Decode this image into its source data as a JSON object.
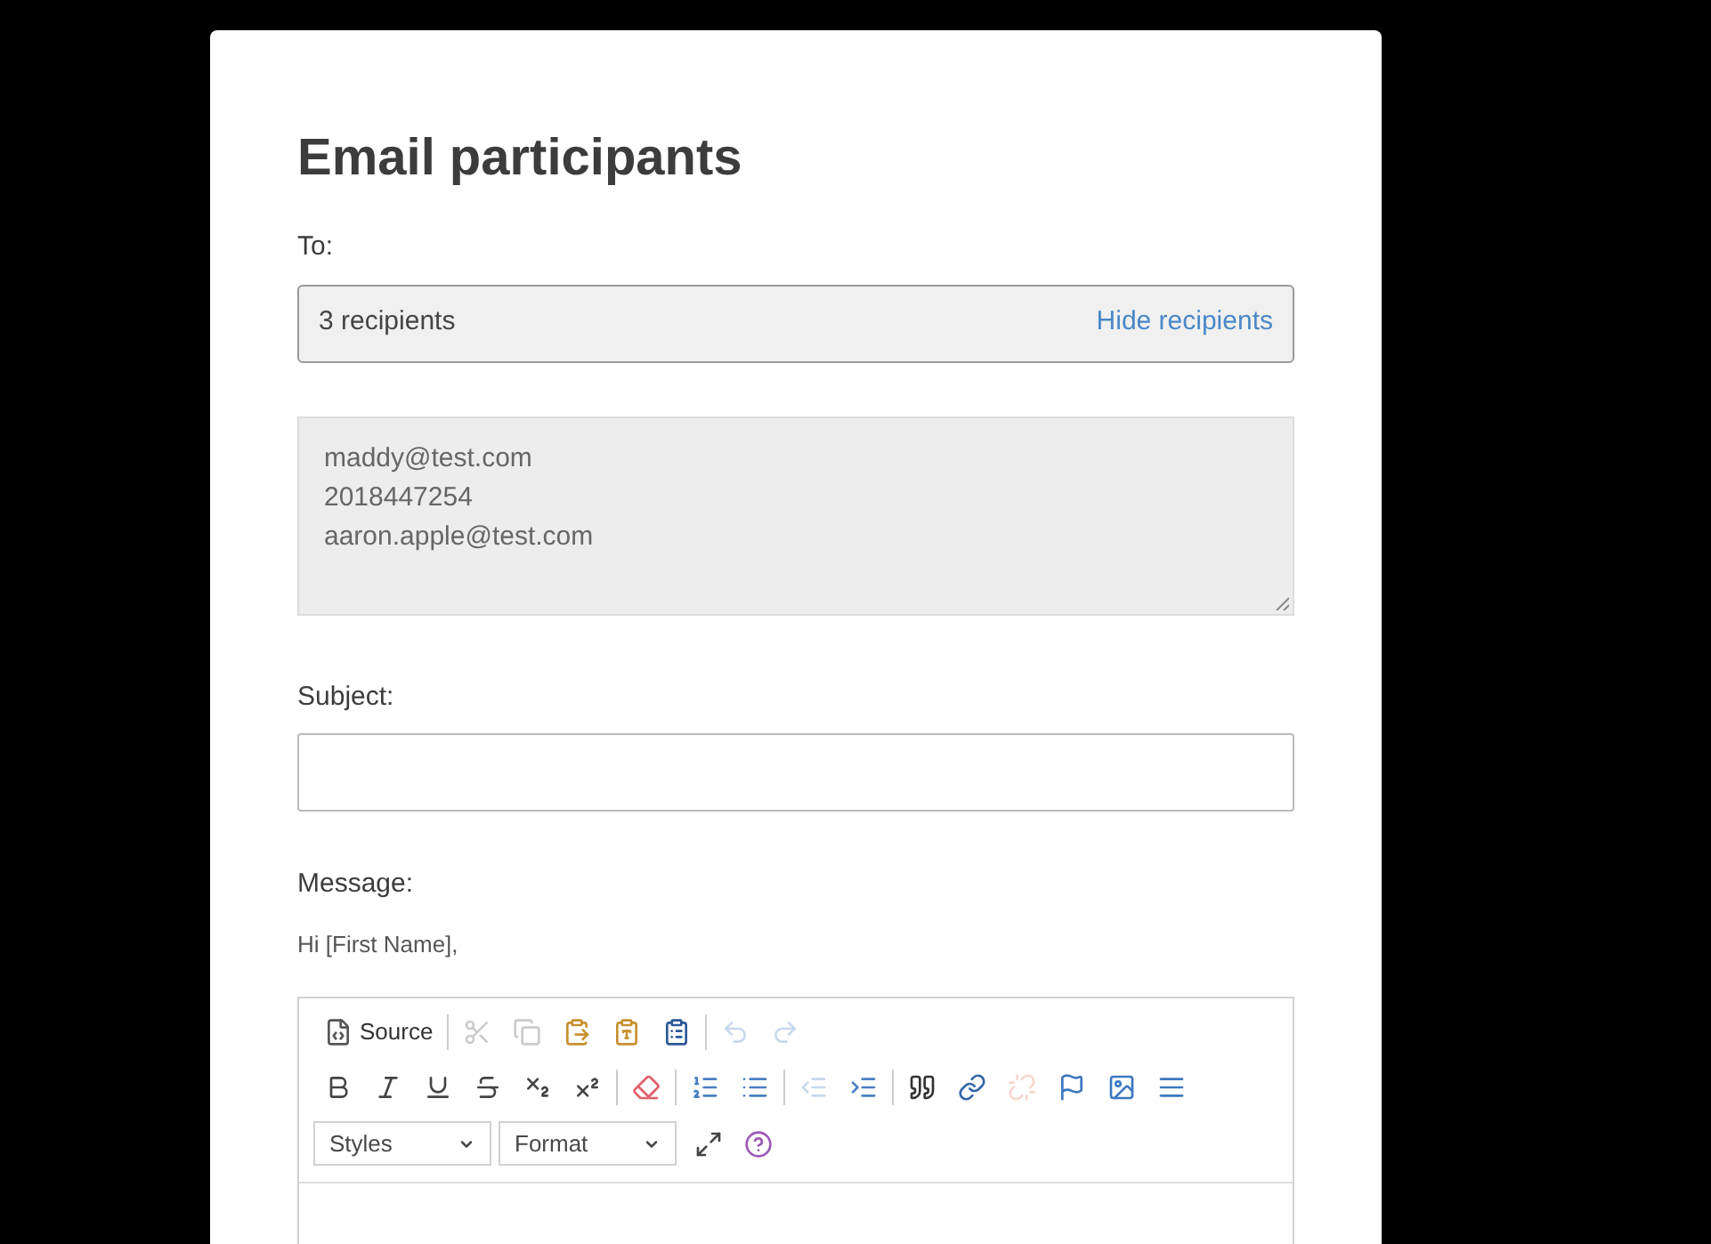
{
  "dialog": {
    "title": "Email participants"
  },
  "to": {
    "label": "To:",
    "summary": "3 recipients",
    "toggle_link": "Hide recipients"
  },
  "recipients": [
    "maddy@test.com",
    "2018447254",
    "aaron.apple@test.com"
  ],
  "subject": {
    "label": "Subject:"
  },
  "message": {
    "label": "Message:",
    "greeting": "Hi [First Name],"
  },
  "editor_toolbar": [
    [
      [
        {
          "kind": "source",
          "label": "Source",
          "disabled": false
        }
      ],
      [
        {
          "kind": "cut",
          "disabled": true
        },
        {
          "kind": "copy",
          "disabled": true
        },
        {
          "kind": "paste",
          "disabled": false
        },
        {
          "kind": "paste-text",
          "disabled": false
        },
        {
          "kind": "paste-word",
          "disabled": false
        }
      ],
      [
        {
          "kind": "undo",
          "disabled": true
        },
        {
          "kind": "redo",
          "disabled": true
        }
      ]
    ],
    [
      [
        {
          "kind": "bold",
          "disabled": false
        },
        {
          "kind": "italic",
          "disabled": false
        },
        {
          "kind": "underline",
          "disabled": false
        },
        {
          "kind": "strike",
          "disabled": false
        },
        {
          "kind": "subscript",
          "disabled": false
        },
        {
          "kind": "superscript",
          "disabled": false
        }
      ],
      [
        {
          "kind": "eraser",
          "disabled": false
        }
      ],
      [
        {
          "kind": "numbered-list",
          "disabled": false
        },
        {
          "kind": "bullet-list",
          "disabled": false
        }
      ],
      [
        {
          "kind": "outdent",
          "disabled": true
        },
        {
          "kind": "indent",
          "disabled": false
        }
      ],
      [
        {
          "kind": "quote",
          "disabled": false
        },
        {
          "kind": "link",
          "disabled": false
        },
        {
          "kind": "unlink",
          "disabled": true
        },
        {
          "kind": "flag",
          "disabled": false
        },
        {
          "kind": "image",
          "disabled": false
        },
        {
          "kind": "rule",
          "disabled": false
        }
      ]
    ],
    [
      [
        {
          "kind": "dropdown",
          "label": "Styles",
          "disabled": false
        },
        {
          "kind": "dropdown",
          "label": "Format",
          "disabled": false
        },
        {
          "kind": "maximize",
          "disabled": false
        },
        {
          "kind": "help",
          "disabled": false
        }
      ]
    ]
  ]
}
